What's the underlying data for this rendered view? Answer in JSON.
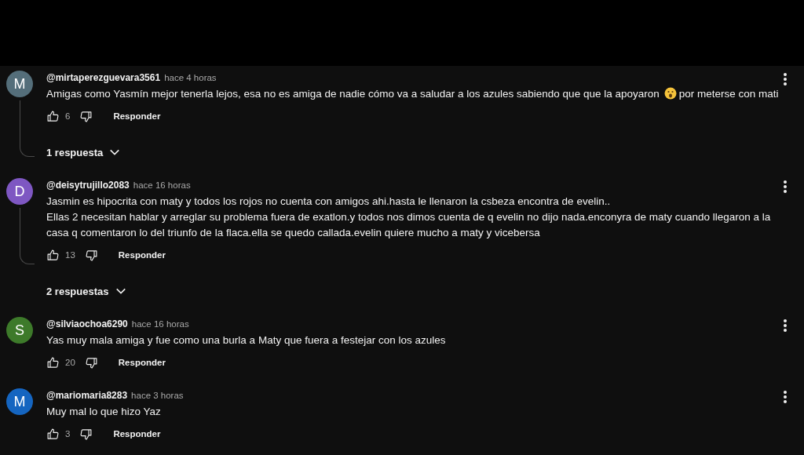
{
  "comments": [
    {
      "initial": "M",
      "color": "#546e7a",
      "author": "@mirtaperezguevara3561",
      "time": "hace 4 horas",
      "paragraphs": [
        {
          "parts": [
            {
              "kind": "text",
              "text": "Amigas como Yasmín mejor tenerla lejos, esa no es amiga de nadie cómo va a saludar a los azules sabiendo que que la apoyaron"
            },
            {
              "kind": "emoji"
            },
            {
              "kind": "text",
              "text": "por meterse con mati"
            }
          ]
        }
      ],
      "likes": "6",
      "reply_label": "Responder",
      "replies": "1 respuesta"
    },
    {
      "initial": "D",
      "color": "#7e57c2",
      "author": "@deisytrujillo2083",
      "time": "hace 16 horas",
      "paragraphs": [
        {
          "parts": [
            {
              "kind": "text",
              "text": "Jasmin es hipocrita con maty y todos los rojos no cuenta con amigos ahi.hasta le llenaron la csbeza encontra de evelin.."
            }
          ]
        },
        {
          "parts": [
            {
              "kind": "text",
              "text": "Ellas 2 necesitan hablar y arreglar su problema fuera de exatlon.y todos nos dimos cuenta de q evelin no dijo nada.enconyra de maty cuando llegaron a la casa q comentaron lo del triunfo de la flaca.ella se quedo callada.evelin quiere mucho a maty y vicebersa"
            }
          ]
        }
      ],
      "likes": "13",
      "reply_label": "Responder",
      "replies": "2 respuestas"
    },
    {
      "initial": "S",
      "color": "#3d7a2a",
      "author": "@silviaochoa6290",
      "time": "hace 16 horas",
      "paragraphs": [
        {
          "parts": [
            {
              "kind": "text",
              "text": "Yas muy mala amiga y fue como una burla a Maty que fuera a festejar con los azules"
            }
          ]
        }
      ],
      "likes": "20",
      "reply_label": "Responder"
    },
    {
      "initial": "M",
      "color": "#1565c0",
      "author": "@mariomaria8283",
      "time": "hace 3 horas",
      "paragraphs": [
        {
          "parts": [
            {
              "kind": "text",
              "text": "Muy mal lo que hizo Yaz"
            }
          ]
        }
      ],
      "likes": "3",
      "reply_label": "Responder"
    }
  ]
}
